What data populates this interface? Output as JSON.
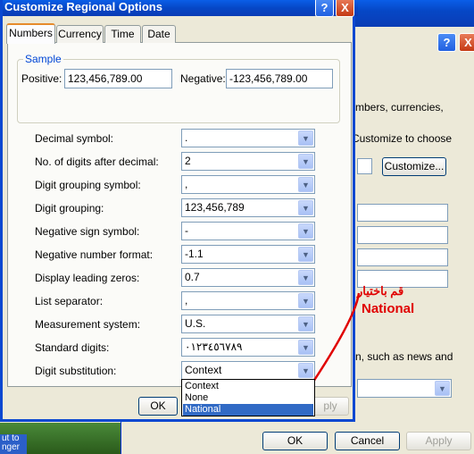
{
  "back_window": {
    "help": "?",
    "close": "X",
    "text1": "mbers, currencies,",
    "text2": "Customize to choose",
    "customize_label": "Customize...",
    "text3": "n, such as news and",
    "ok": "OK",
    "cancel": "Cancel",
    "apply": "Apply"
  },
  "desktop": {
    "text": "ut to\nnger"
  },
  "dialog": {
    "title": "Customize Regional Options",
    "help": "?",
    "close": "X",
    "tabs": [
      {
        "label": "Numbers"
      },
      {
        "label": "Currency"
      },
      {
        "label": "Time"
      },
      {
        "label": "Date"
      }
    ],
    "sample": {
      "legend": "Sample",
      "positive_label": "Positive:",
      "positive_value": "123,456,789.00",
      "negative_label": "Negative:",
      "negative_value": "-123,456,789.00"
    },
    "settings": [
      {
        "label": "Decimal symbol:",
        "value": "."
      },
      {
        "label": "No. of digits after decimal:",
        "value": "2"
      },
      {
        "label": "Digit grouping symbol:",
        "value": ","
      },
      {
        "label": "Digit grouping:",
        "value": "123,456,789"
      },
      {
        "label": "Negative sign symbol:",
        "value": "-"
      },
      {
        "label": "Negative number format:",
        "value": "-1.1"
      },
      {
        "label": "Display leading zeros:",
        "value": "0.7"
      },
      {
        "label": "List separator:",
        "value": ","
      },
      {
        "label": "Measurement system:",
        "value": "U.S."
      },
      {
        "label": "Standard digits:",
        "value": "٠١٢٣٤٥٦٧٨٩"
      },
      {
        "label": "Digit substitution:",
        "value": "Context"
      }
    ],
    "dropdown_options": [
      "Context",
      "None",
      "National"
    ],
    "dropdown_selected": "National",
    "ok": "OK",
    "apply_partial": "ply"
  },
  "annotation": {
    "arabic": "قم باختيار",
    "english": "National",
    "color": "#e00000"
  }
}
